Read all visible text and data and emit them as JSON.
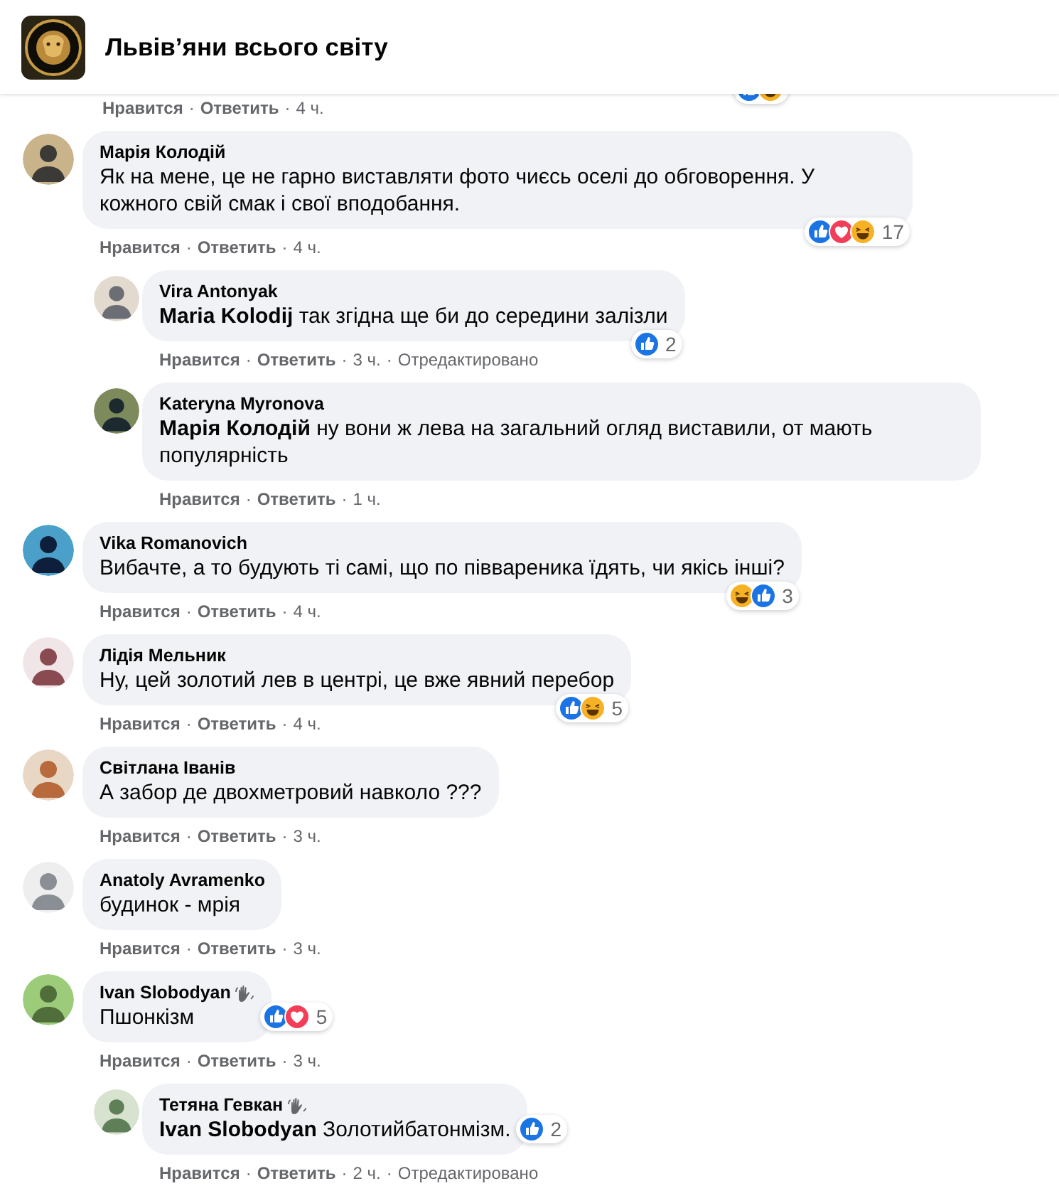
{
  "group": {
    "title": "Львів’яни всього світу"
  },
  "separator": "·",
  "previous_actions": {
    "like": "Нравится",
    "reply": "Ответить",
    "time": "4 ч.",
    "reactions": [
      {
        "kind": "like"
      },
      {
        "kind": "haha"
      }
    ]
  },
  "comments": [
    {
      "author": "Марія Колодій",
      "badge": false,
      "text": "Як на мене, це не гарно виставляти фото чиєсь оселі до обговорення. У кожного свій смак і свої вподобання.",
      "reactions": [
        {
          "kind": "like"
        },
        {
          "kind": "love"
        },
        {
          "kind": "haha"
        }
      ],
      "count": "17",
      "actions": {
        "like": "Нравится",
        "reply": "Ответить",
        "time": "4 ч."
      },
      "replies": [
        {
          "author": "Vira Antonyak",
          "badge": false,
          "text": "**Maria Kolodij** так згідна ще би до середини залізли",
          "reactions": [
            {
              "kind": "like"
            }
          ],
          "count": "2",
          "actions": {
            "like": "Нравится",
            "reply": "Ответить",
            "time": "3 ч.",
            "edited": "Отредактировано"
          }
        },
        {
          "author": "Kateryna Myronova",
          "badge": false,
          "text": "**Марія Колодій** ну вони ж лева на загальний огляд виставили, от мають популярність",
          "actions": {
            "like": "Нравится",
            "reply": "Ответить",
            "time": "1 ч."
          }
        }
      ]
    },
    {
      "author": "Vika Romanovich",
      "badge": false,
      "text": "Вибачте, а то будують ті самі, що по піввареника їдять, чи якісь інші?",
      "reactions": [
        {
          "kind": "haha"
        },
        {
          "kind": "like"
        }
      ],
      "count": "3",
      "actions": {
        "like": "Нравится",
        "reply": "Ответить",
        "time": "4 ч."
      }
    },
    {
      "author": "Лідія Мельник",
      "badge": false,
      "text": "Ну, цей золотий лев в центрі, це вже явний перебор",
      "reactions": [
        {
          "kind": "like"
        },
        {
          "kind": "haha"
        }
      ],
      "count": "5",
      "actions": {
        "like": "Нравится",
        "reply": "Ответить",
        "time": "4 ч."
      }
    },
    {
      "author": "Світлана Іванів",
      "badge": false,
      "text": "А забор де двохметровий навколо ???",
      "actions": {
        "like": "Нравится",
        "reply": "Ответить",
        "time": "3 ч."
      }
    },
    {
      "author": "Anatoly Avramenko",
      "badge": false,
      "text": "будинок - мрія",
      "actions": {
        "like": "Нравится",
        "reply": "Ответить",
        "time": "3 ч."
      }
    },
    {
      "author": "Ivan Slobodyan",
      "badge": true,
      "text": "Пшонкізм",
      "reactions": [
        {
          "kind": "like"
        },
        {
          "kind": "love"
        }
      ],
      "count": "5",
      "actions": {
        "like": "Нравится",
        "reply": "Ответить",
        "time": "3 ч."
      },
      "replies": [
        {
          "author": "Тетяна Гевкан",
          "badge": true,
          "text": "**Ivan Slobodyan** Золотийбатонмізм.",
          "reactions": [
            {
              "kind": "like"
            }
          ],
          "count": "2",
          "actions": {
            "like": "Нравится",
            "reply": "Ответить",
            "time": "2 ч.",
            "edited": "Отредактировано"
          }
        }
      ]
    }
  ]
}
